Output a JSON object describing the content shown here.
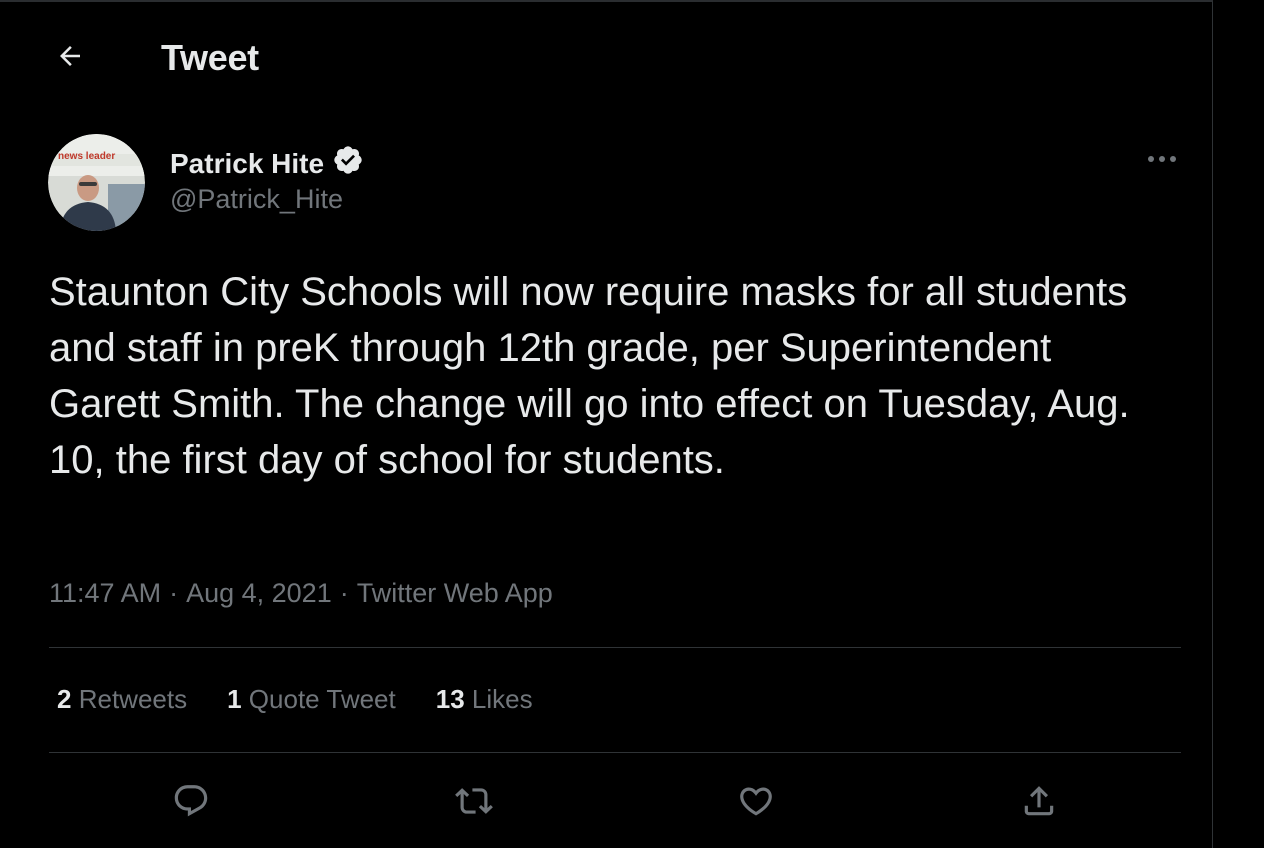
{
  "header": {
    "title": "Tweet",
    "back_icon": "arrow-left-icon"
  },
  "author": {
    "name": "Patrick Hite",
    "handle": "@Patrick_Hite",
    "verified": true,
    "avatar_logo_text": "news leader"
  },
  "tweet": {
    "text": "Staunton City Schools will now require masks for all students and staff in preK through 12th grade, per Superintendent Garett Smith. The change will go into effect on Tuesday, Aug. 10, the first day of school for students.",
    "time": "11:47 AM",
    "date": "Aug 4, 2021",
    "source": "Twitter Web App",
    "separator": "·"
  },
  "stats": {
    "retweets_count": "2",
    "retweets_label": "Retweets",
    "quotes_count": "1",
    "quotes_label": "Quote Tweet",
    "likes_count": "13",
    "likes_label": "Likes"
  },
  "actions": [
    "reply-icon",
    "retweet-icon",
    "like-icon",
    "share-icon"
  ],
  "colors": {
    "background": "#000000",
    "text_primary": "#e7e9ea",
    "text_secondary": "#71767b",
    "border": "#2f3336"
  }
}
